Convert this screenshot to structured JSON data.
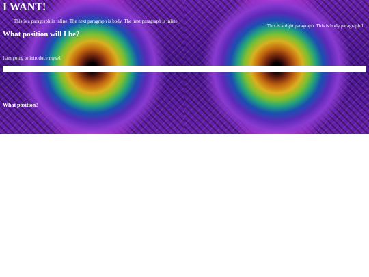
{
  "page": {
    "heading": "I WANT!",
    "inline_paragraph": "This is a paragraph in inline. The next paragraph is body. The next paragraph is inline.",
    "right_paragraph": "This is a right paragraph. This is body paragraph 1.",
    "position_heading": "What position will I be?",
    "intro_text": "I am going to introduce myself",
    "question_text": "What position?"
  },
  "colors": {
    "background": "#ffffff",
    "text": "#ffffff",
    "bar": "#ffffff"
  }
}
